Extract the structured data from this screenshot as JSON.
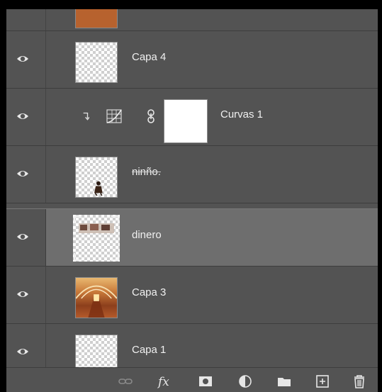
{
  "layers": [
    {
      "name": "",
      "kind": "color-fill",
      "color": "#b7622e",
      "selected": false
    },
    {
      "name": "Capa 4",
      "kind": "pixel",
      "selected": false
    },
    {
      "name": "Curvas 1",
      "kind": "adjustment-curves",
      "clipped": true,
      "selected": false
    },
    {
      "name": "ninño.",
      "kind": "pixel",
      "selected": false
    },
    {
      "name": "dinero",
      "kind": "smart-object",
      "selected": true
    },
    {
      "name": "Capa 3",
      "kind": "photo",
      "selected": false
    },
    {
      "name": "Capa 1",
      "kind": "pixel",
      "selected": false
    }
  ],
  "footer_icons": [
    "link-layers-icon",
    "fx-icon",
    "add-mask-icon",
    "adjustment-layer-icon",
    "group-folder-icon",
    "new-layer-icon",
    "trash-icon"
  ],
  "colors": {
    "panel": "#535353",
    "selected": "#6e6e6e",
    "text": "#f0f0f0"
  }
}
